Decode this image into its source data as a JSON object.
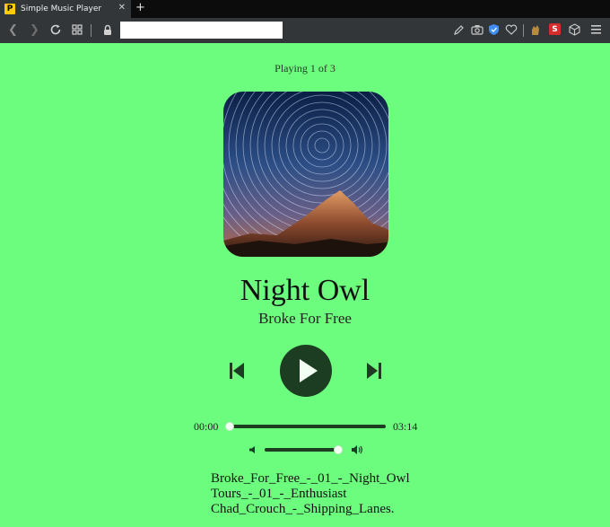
{
  "browser": {
    "tab_title": "Simple Music Player",
    "tab_favicon_letter": "P",
    "tab_close": "✕",
    "new_tab": "+",
    "url": ""
  },
  "player": {
    "status": "Playing 1 of 3",
    "track_title": "Night Owl",
    "artist": "Broke For Free",
    "current_time": "00:00",
    "total_time": "03:14",
    "progress": 0.0,
    "volume": 0.95,
    "accent_color": "#1d3d22",
    "background_color": "#6cfc7e"
  },
  "playlist": [
    "Broke_For_Free_-_01_-_Night_Owl",
    "Tours_-_01_-_Enthusiast",
    "Chad_Crouch_-_Shipping_Lanes."
  ],
  "icons": [
    "back-arrow-icon",
    "forward-arrow-icon",
    "reload-icon",
    "grid-icon",
    "lock-icon",
    "edit-icon",
    "camera-icon",
    "shield-icon",
    "heart-icon",
    "extension-icon",
    "s-badge-icon",
    "cube-icon",
    "menu-icon"
  ]
}
